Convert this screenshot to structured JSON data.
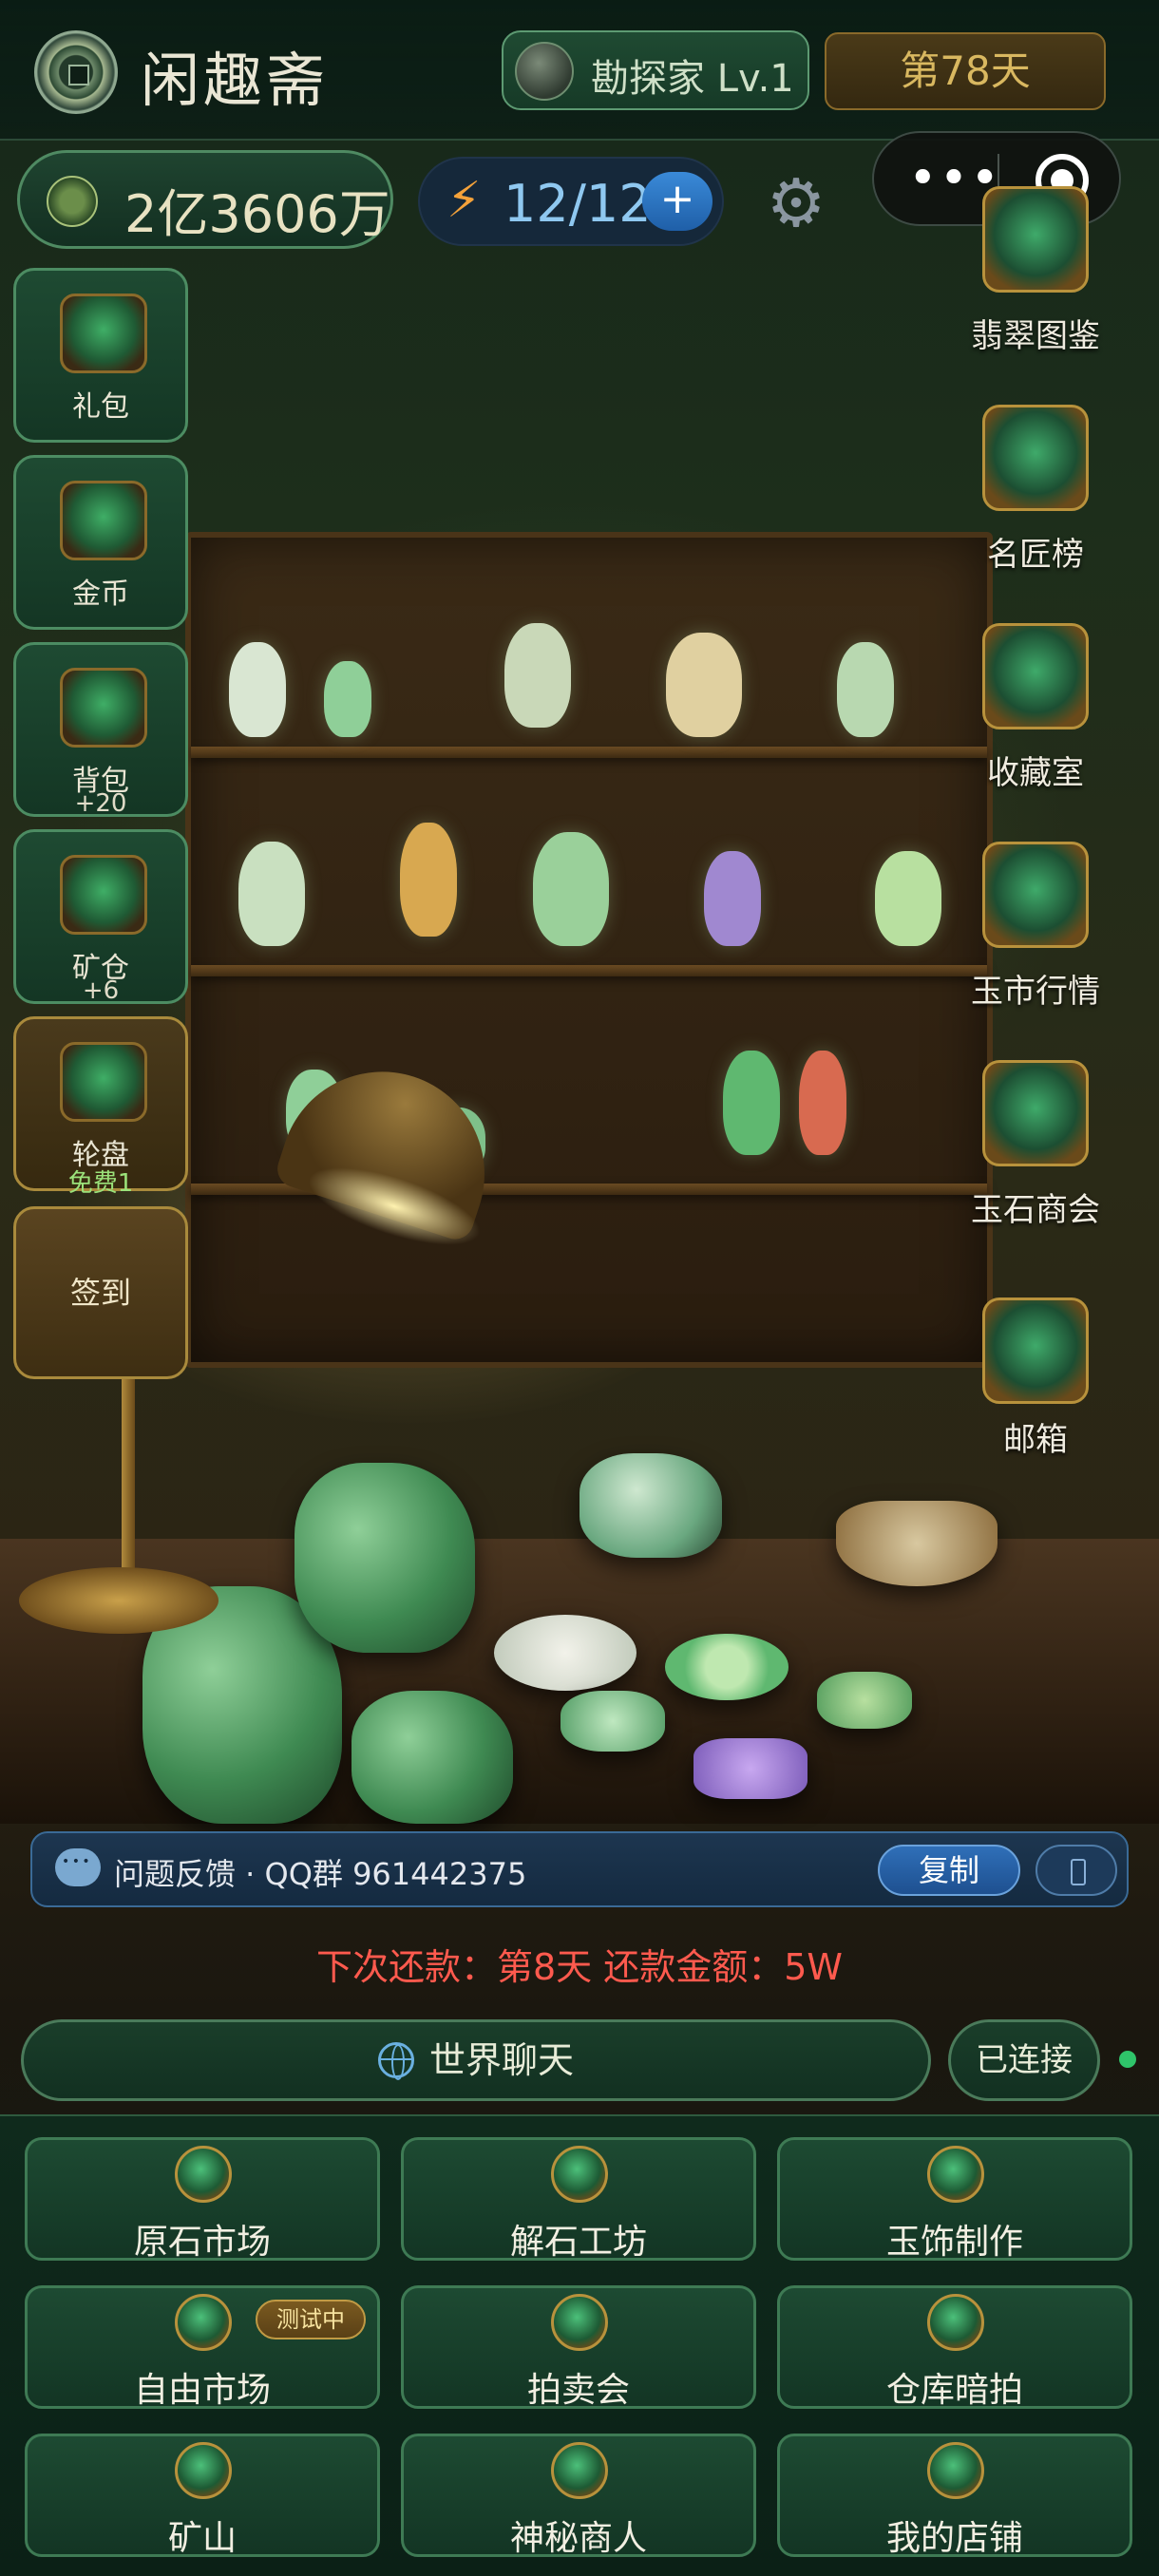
{
  "app": {
    "title": "闲趣斋"
  },
  "header": {
    "rank_text": "勘探家 Lv.1",
    "day_text": "第78天",
    "money": "2亿3606万",
    "energy": "12/12",
    "energy_plus": "+"
  },
  "capsule": {
    "more": "•••"
  },
  "left_menu": [
    {
      "label": "礼包",
      "sub": ""
    },
    {
      "label": "金币",
      "sub": ""
    },
    {
      "label": "背包",
      "sub": "+20"
    },
    {
      "label": "矿仓",
      "sub": "+6"
    },
    {
      "label": "轮盘",
      "sub": "免费1"
    }
  ],
  "signin_label": "签到",
  "right_menu": [
    {
      "label": "翡翠图鉴"
    },
    {
      "label": "名匠榜"
    },
    {
      "label": "收藏室"
    },
    {
      "label": "玉市行情"
    },
    {
      "label": "玉石商会"
    },
    {
      "label": "邮箱"
    }
  ],
  "feedback": {
    "text": "问题反馈 · QQ群 961442375",
    "copy_label": "复制"
  },
  "repay_notice": "下次还款：第8天 还款金额：5W",
  "chat": {
    "world_label": "世界聊天",
    "status": "已连接"
  },
  "grid": [
    {
      "label": "原石市场"
    },
    {
      "label": "解石工坊"
    },
    {
      "label": "玉饰制作"
    },
    {
      "label": "自由市场",
      "badge": "测试中"
    },
    {
      "label": "拍卖会"
    },
    {
      "label": "仓库暗拍"
    },
    {
      "label": "矿山"
    },
    {
      "label": "神秘商人"
    },
    {
      "label": "我的店铺"
    }
  ],
  "colors": {
    "accent_green": "#4c8c62",
    "gold": "#a98a3c",
    "repay_red": "#ff5a4e",
    "energy_blue": "#8fc8f0",
    "connected_dot": "#2fc46a"
  }
}
